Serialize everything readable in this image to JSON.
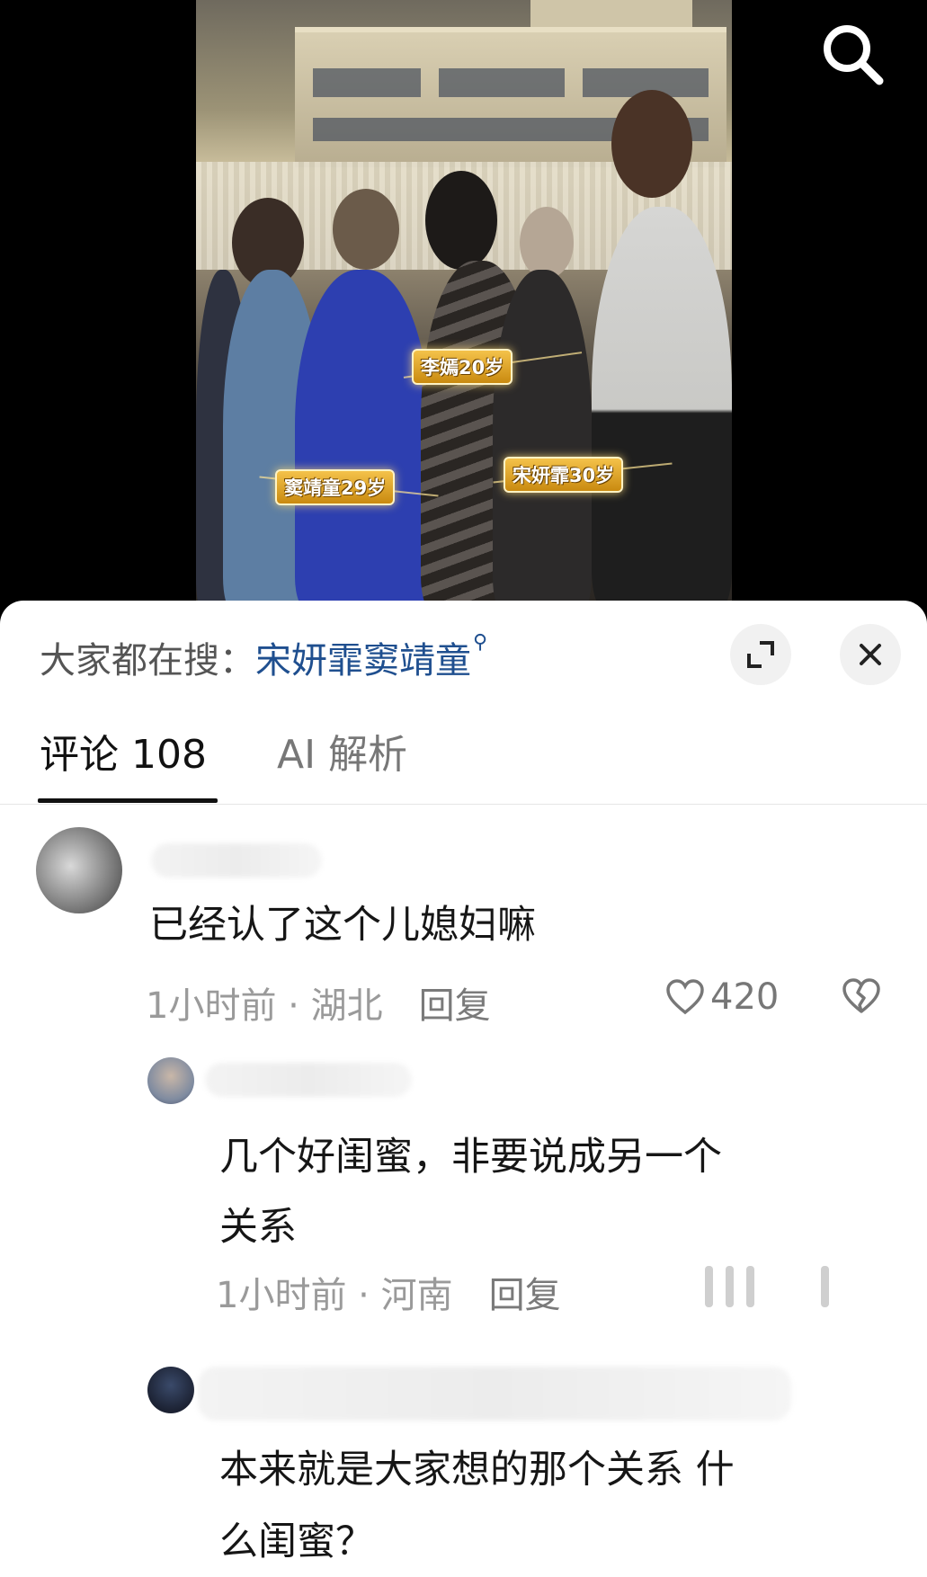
{
  "video": {
    "overlay_tags": [
      {
        "label": "李嫣20岁"
      },
      {
        "label": "窦靖童29岁"
      },
      {
        "label": "宋妍霏30岁"
      }
    ]
  },
  "hot_search": {
    "prefix": "大家都在搜：",
    "query": "宋妍霏窦靖童"
  },
  "tabs": {
    "comments": "评论 108",
    "ai": "AI 解析"
  },
  "comments": [
    {
      "text": "已经认了这个儿媳妇嘛",
      "time": "1小时前",
      "location": "湖北",
      "reply": "回复",
      "likes": "420"
    },
    {
      "text_line1": "几个好闺蜜，非要说成另一个",
      "text_line2": "关系",
      "time": "1小时前",
      "location": "河南",
      "reply": "回复"
    },
    {
      "text_line1": "本来就是大家想的那个关系 什",
      "text_line2": "么闺蜜？"
    }
  ],
  "colors": {
    "link": "#1f4f8f",
    "meta": "#9a9a9a",
    "tag_gold": "#e0a020"
  }
}
